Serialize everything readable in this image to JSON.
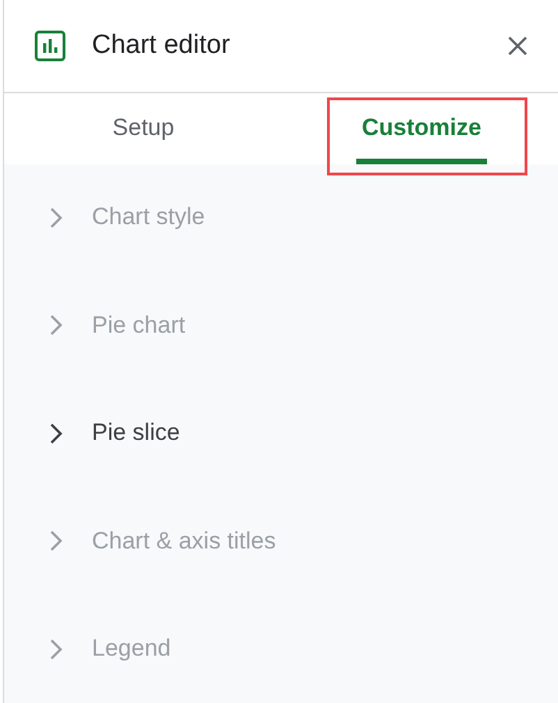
{
  "window": {
    "title": "Chart editor"
  },
  "tabs": [
    {
      "label": "Setup",
      "selected": false,
      "highlighted": false
    },
    {
      "label": "Customize",
      "selected": true,
      "highlighted": true
    }
  ],
  "sections": [
    {
      "label": "Chart style",
      "disabled": true
    },
    {
      "label": "Pie chart",
      "disabled": true
    },
    {
      "label": "Pie slice",
      "disabled": false
    },
    {
      "label": "Chart & axis titles",
      "disabled": true
    },
    {
      "label": "Legend",
      "disabled": true
    }
  ]
}
